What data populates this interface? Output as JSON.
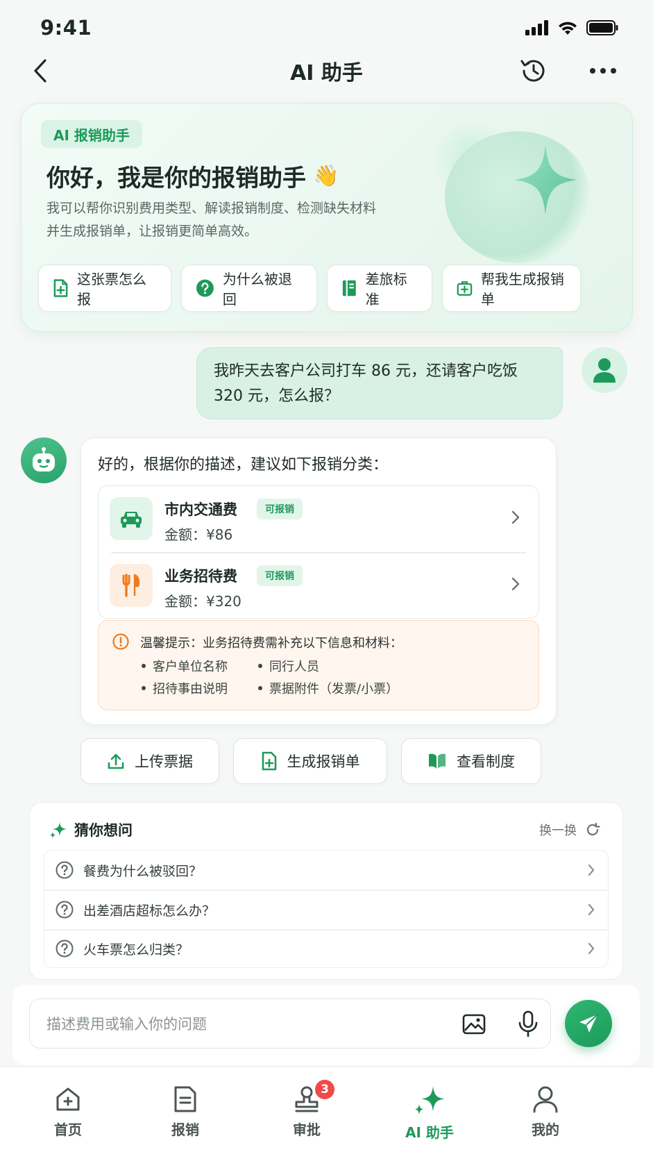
{
  "status": {
    "time": "9:41"
  },
  "nav": {
    "title": "AI 助手"
  },
  "hero": {
    "tag": "AI 报销助手",
    "title": "你好，我是你的报销助手",
    "emoji": "👋",
    "desc_line1": "我可以帮你识别费用类型、解读报销制度、检测缺失材料",
    "desc_line2": "并生成报销单，让报销更简单高效。",
    "quick": [
      {
        "label": "这张票怎么报",
        "icon": "receipt-add-icon"
      },
      {
        "label": "为什么被退回",
        "icon": "question-circle-icon"
      },
      {
        "label": "差旅标准",
        "icon": "book-icon"
      },
      {
        "label": "帮我生成报销单",
        "icon": "medical-bag-icon"
      }
    ]
  },
  "user_message": {
    "line1": "我昨天去客户公司打车 86 元，还请客户吃饭",
    "line2": "320 元，怎么报？"
  },
  "bot_message": {
    "intro": "好的，根据你的描述，建议如下报销分类：",
    "categories": [
      {
        "name": "市内交通费",
        "badge": "可报销",
        "amount": "金额：¥86",
        "icon": "car-icon"
      },
      {
        "name": "业务招待费",
        "badge": "可报销",
        "amount": "金额：¥320",
        "icon": "utensils-icon"
      }
    ],
    "tip": {
      "title": "温馨提示：业务招待费需补充以下信息和材料：",
      "items": [
        "客户单位名称",
        "同行人员",
        "招待事由说明",
        "票据附件（发票/小票）"
      ]
    }
  },
  "actions": [
    {
      "label": "上传票据",
      "icon": "upload-icon"
    },
    {
      "label": "生成报销单",
      "icon": "receipt-add-icon"
    },
    {
      "label": "查看制度",
      "icon": "book-open-icon"
    }
  ],
  "suggest": {
    "title": "猜你想问",
    "refresh": "换一换",
    "items": [
      "餐费为什么被驳回？",
      "出差酒店超标怎么办？",
      "火车票怎么归类？"
    ]
  },
  "composer": {
    "placeholder": "描述费用或输入你的问题"
  },
  "tabs": [
    {
      "label": "首页",
      "icon": "home-icon"
    },
    {
      "label": "报销",
      "icon": "document-icon"
    },
    {
      "label": "审批",
      "icon": "stamp-icon",
      "badge": "3"
    },
    {
      "label": "AI 助手",
      "icon": "sparkle-icon",
      "active": true
    },
    {
      "label": "我的",
      "icon": "user-icon"
    }
  ],
  "colors": {
    "accent": "#1d9a5a",
    "warning": "#f07a1e",
    "badge": "#f04a4a"
  }
}
